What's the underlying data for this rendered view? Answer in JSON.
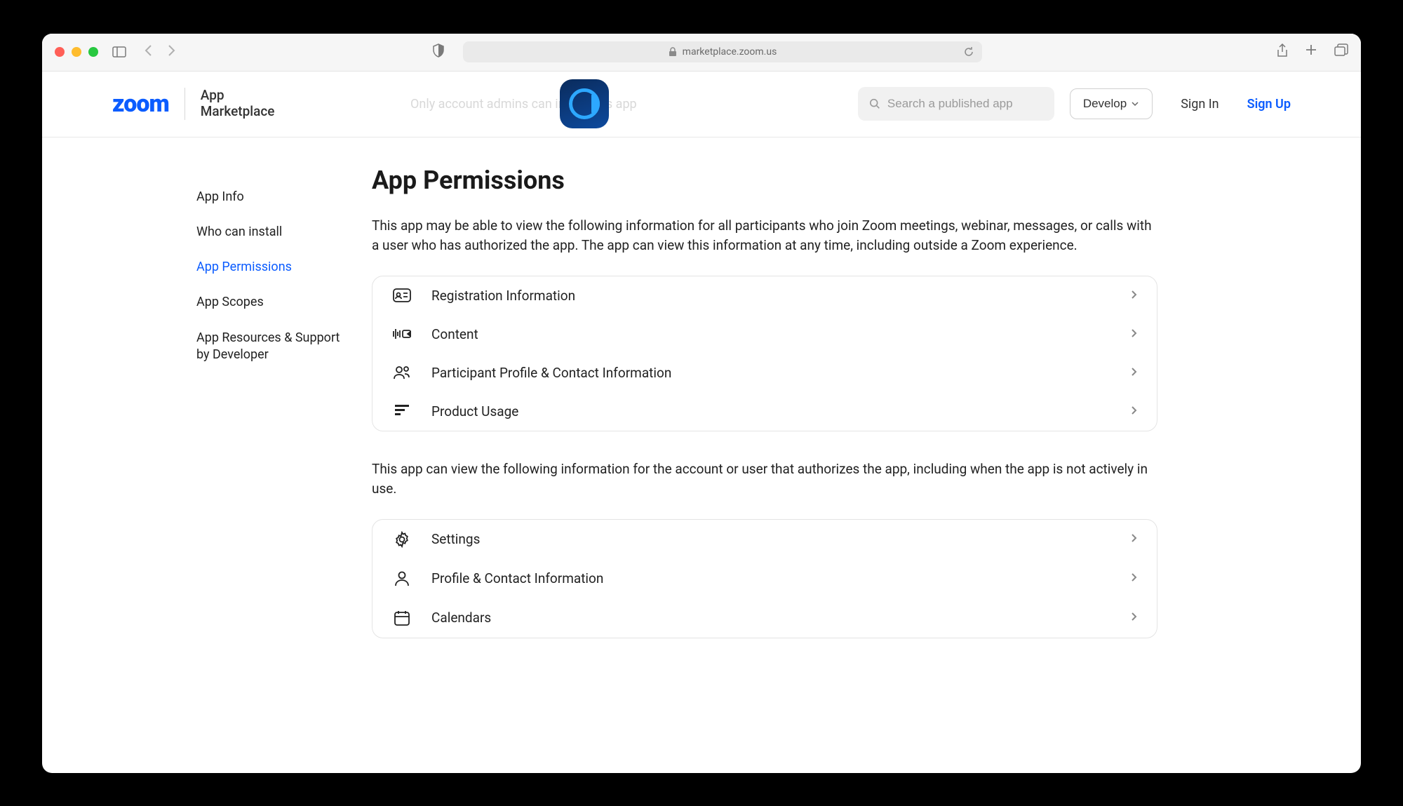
{
  "browser": {
    "url": "marketplace.zoom.us"
  },
  "header": {
    "logo": "zoom",
    "marketplace_l1": "App",
    "marketplace_l2": "Marketplace",
    "notice": "Only account admins can install this app",
    "search_placeholder": "Search a published app",
    "develop": "Develop",
    "signin": "Sign In",
    "signup": "Sign Up"
  },
  "sidebar": {
    "items": [
      {
        "label": "App Info",
        "active": false
      },
      {
        "label": "Who can install",
        "active": false
      },
      {
        "label": "App Permissions",
        "active": true
      },
      {
        "label": "App Scopes",
        "active": false
      },
      {
        "label": "App Resources & Support by Developer",
        "active": false
      }
    ]
  },
  "main": {
    "title": "App Permissions",
    "desc1": "This app may be able to view the following information for all participants who join Zoom meetings, webinar, messages, or calls with a user who has authorized the app. The app can view this information at any time, including outside a Zoom experience.",
    "group1": [
      {
        "icon": "id-card",
        "label": "Registration Information"
      },
      {
        "icon": "content",
        "label": "Content"
      },
      {
        "icon": "participants",
        "label": "Participant Profile & Contact Information"
      },
      {
        "icon": "usage",
        "label": "Product Usage"
      }
    ],
    "desc2": "This app can view the following information for the account or user that authorizes the app, including when the app is not actively in use.",
    "group2": [
      {
        "icon": "gear",
        "label": "Settings"
      },
      {
        "icon": "person",
        "label": "Profile & Contact Information"
      },
      {
        "icon": "calendar",
        "label": "Calendars"
      }
    ]
  }
}
